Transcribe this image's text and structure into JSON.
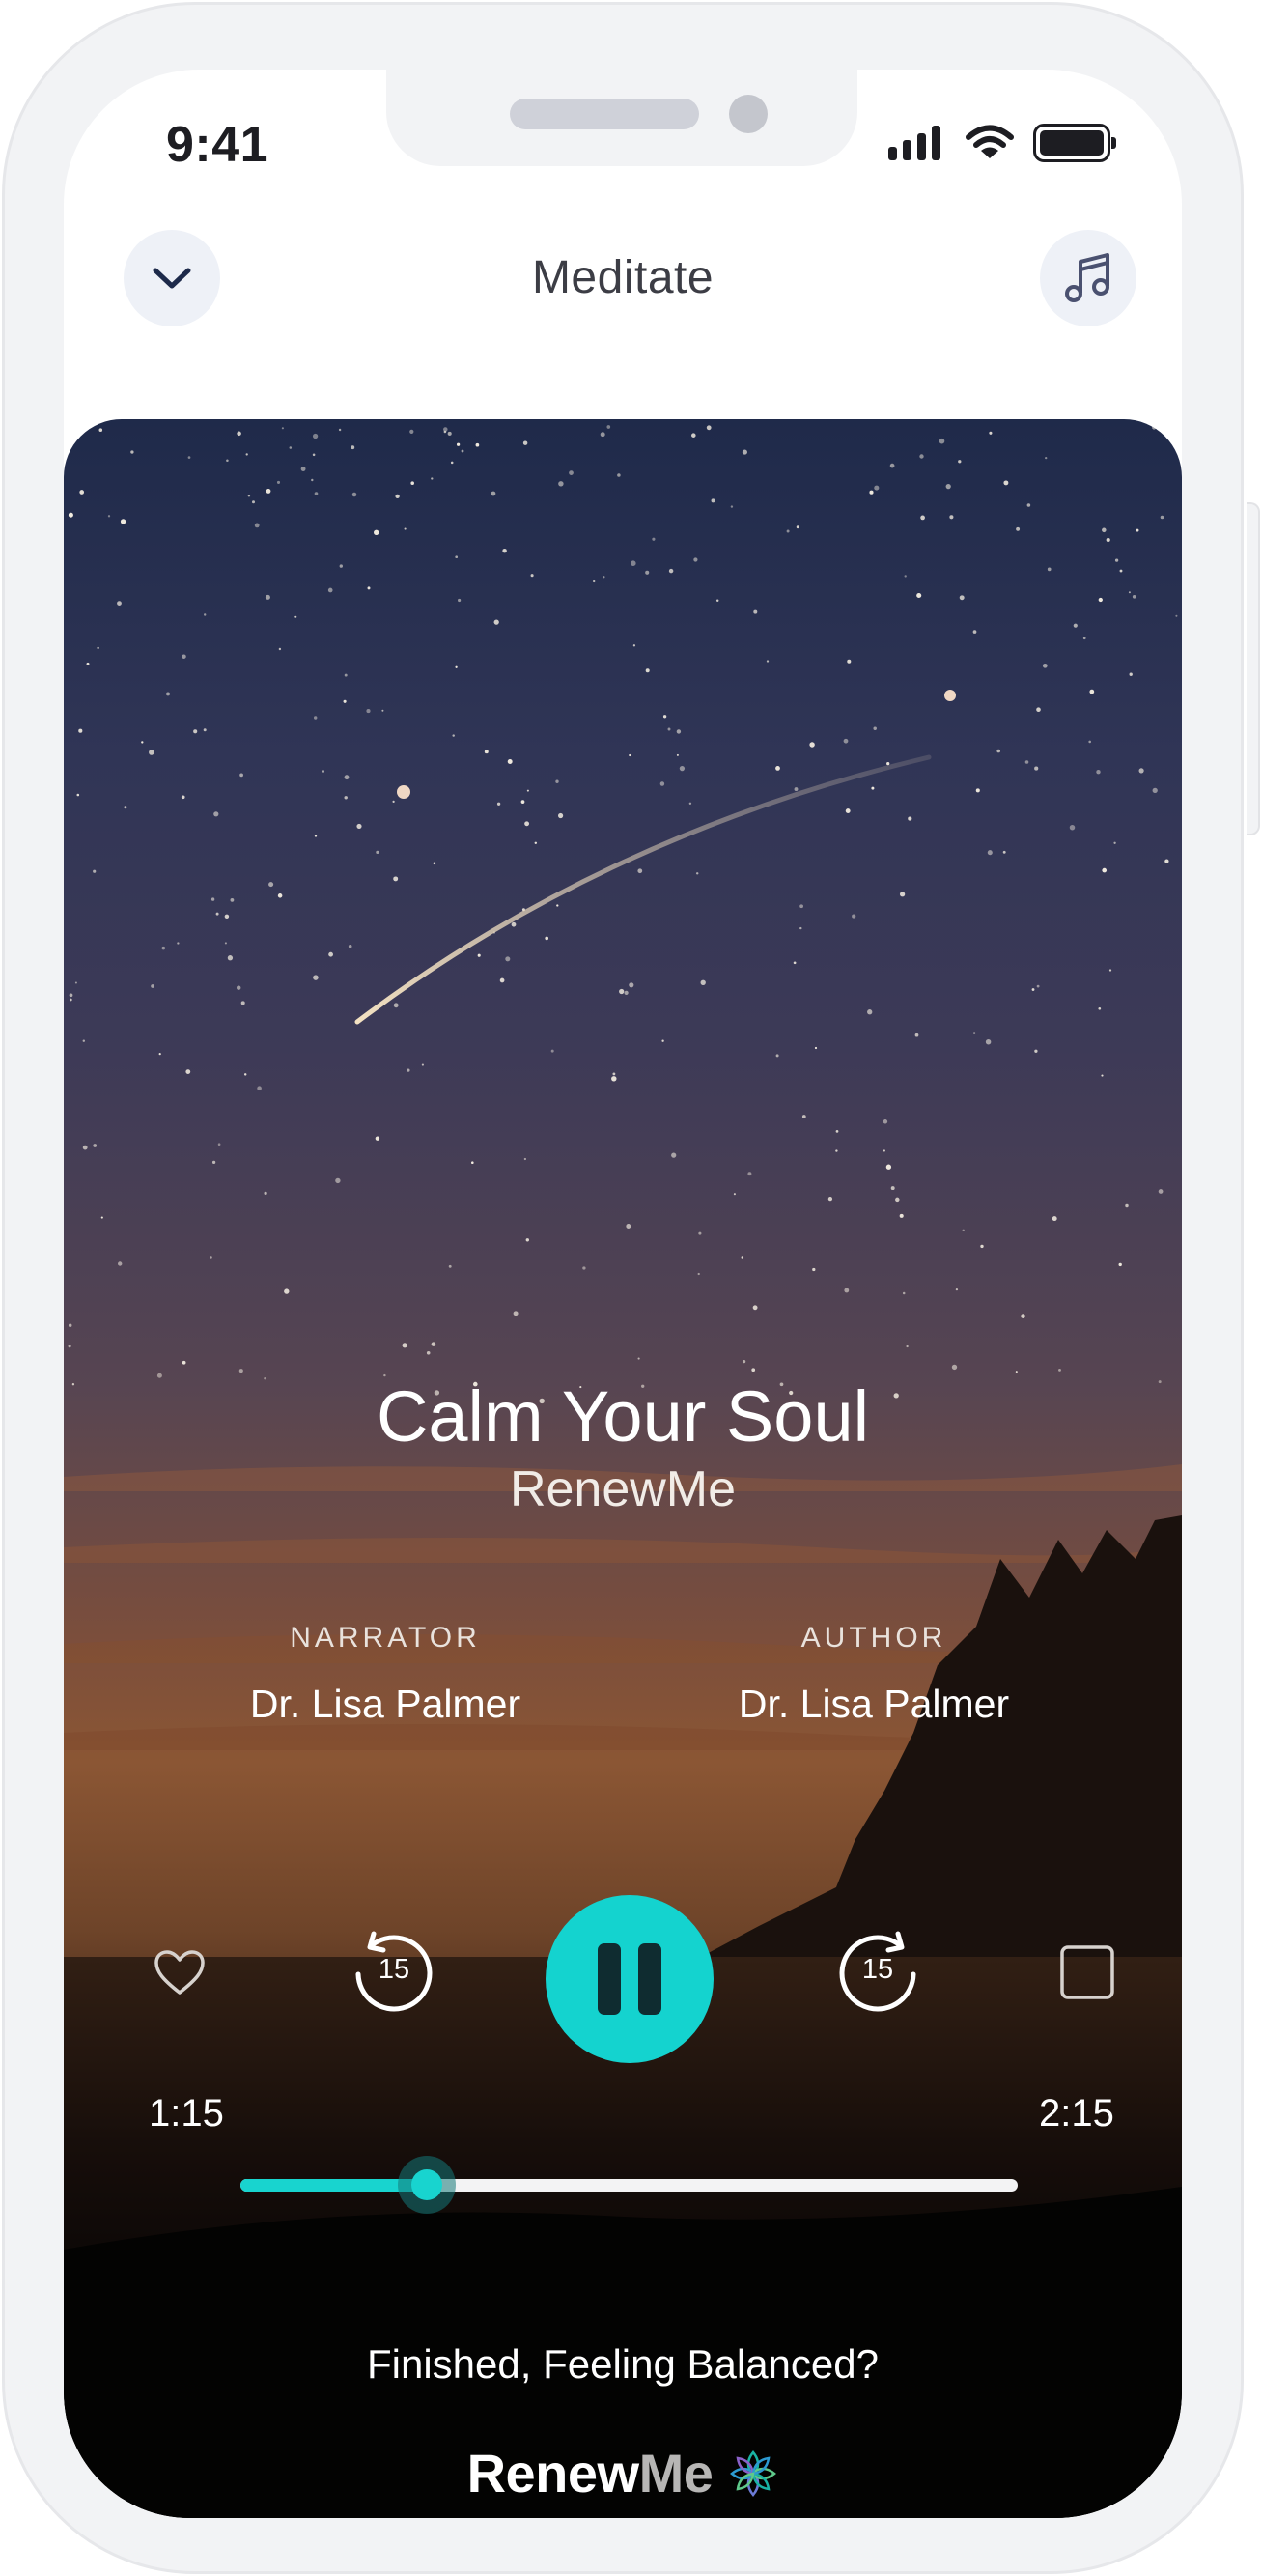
{
  "status_bar": {
    "time": "9:41",
    "icons": [
      "signal-icon",
      "wifi-icon",
      "battery-icon"
    ]
  },
  "nav": {
    "title": "Meditate",
    "left_icon": "chevron-down-icon",
    "right_icon": "music-note-icon"
  },
  "player": {
    "title": "Calm Your Soul",
    "brand": "RenewMe",
    "narrator_label": "NARRATOR",
    "narrator_name": "Dr. Lisa Palmer",
    "author_label": "AUTHOR",
    "author_name": "Dr. Lisa Palmer",
    "controls": {
      "like_icon": "heart-icon",
      "rewind_icon": "rewind-15-icon",
      "rewind_seconds": "15",
      "play_state_icon": "pause-icon",
      "forward_icon": "forward-15-icon",
      "forward_seconds": "15",
      "stop_icon": "stop-icon"
    },
    "elapsed": "1:15",
    "duration": "2:15",
    "progress_fraction": 0.24,
    "accent_color": "#14d3cf"
  },
  "footer": {
    "prompt": "Finished, Feeling Balanced?",
    "logo_part1": "Renew",
    "logo_part2": "Me",
    "logo_icon": "lotus-icon"
  }
}
